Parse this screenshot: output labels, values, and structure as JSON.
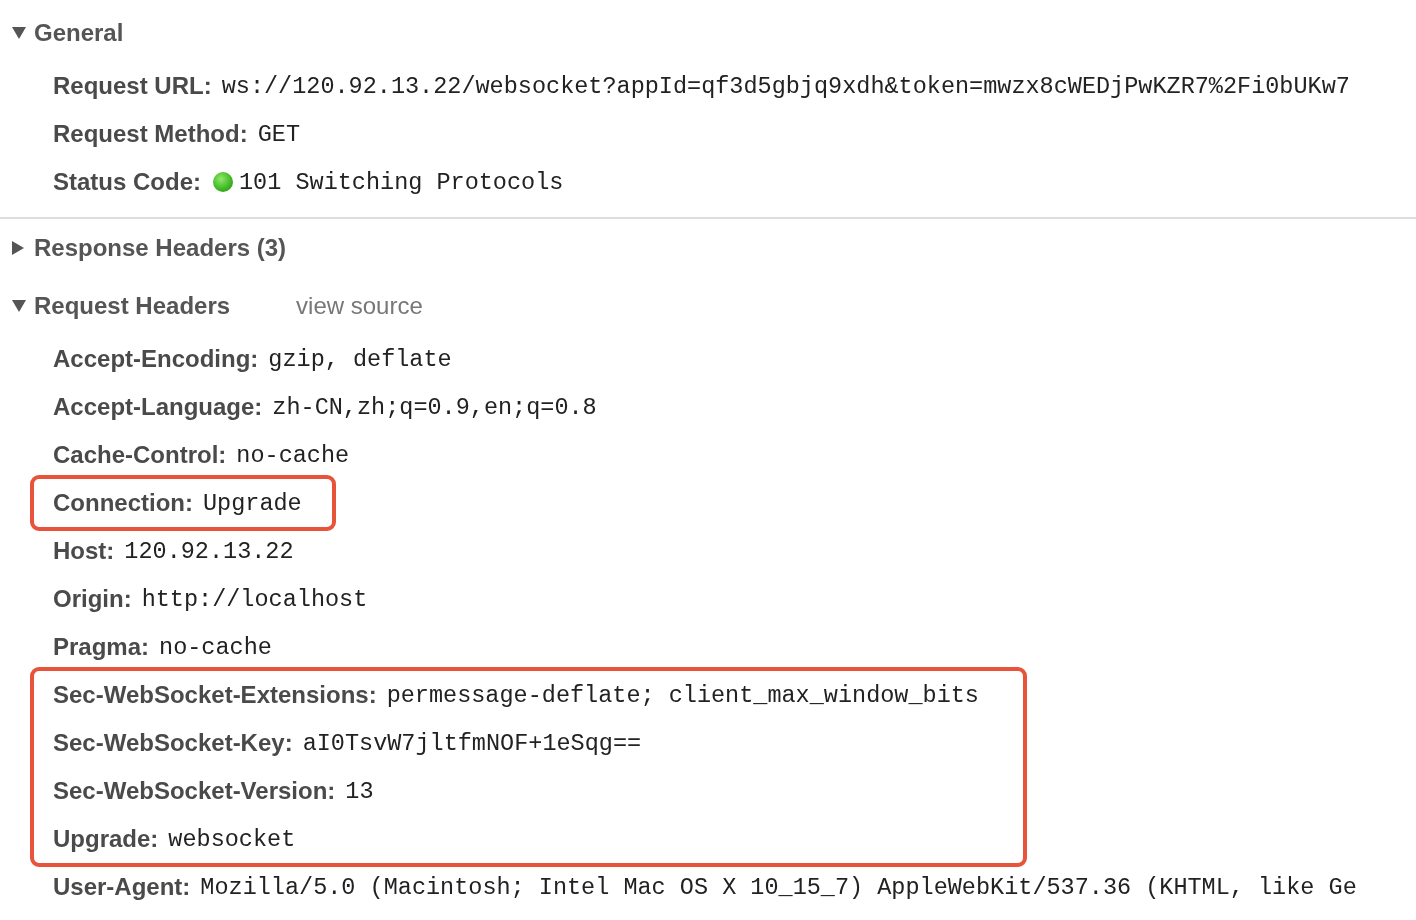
{
  "sections": [
    {
      "title": "General",
      "expanded": true,
      "rows": [
        {
          "label": "Request URL:",
          "value": "ws://120.92.13.22/websocket?appId=qf3d5gbjq9xdh&token=mwzx8cWEDjPwKZR7%2Fi0bUKw7"
        },
        {
          "label": "Request Method:",
          "value": "GET"
        },
        {
          "label": "Status Code:",
          "value": "101 Switching Protocols",
          "ok": true
        }
      ]
    },
    {
      "title": "Response Headers (3)",
      "expanded": false
    },
    {
      "title": "Request Headers",
      "expanded": true,
      "link": "view source",
      "groups": [
        {
          "highlighted": false,
          "rows": [
            {
              "label": "Accept-Encoding:",
              "value": "gzip, deflate"
            },
            {
              "label": "Accept-Language:",
              "value": "zh-CN,zh;q=0.9,en;q=0.8"
            },
            {
              "label": "Cache-Control:",
              "value": "no-cache"
            }
          ]
        },
        {
          "highlighted": true,
          "rows": [
            {
              "label": "Connection:",
              "value": "Upgrade"
            }
          ]
        },
        {
          "highlighted": false,
          "rows": [
            {
              "label": "Host:",
              "value": "120.92.13.22"
            },
            {
              "label": "Origin:",
              "value": "http://localhost"
            },
            {
              "label": "Pragma:",
              "value": "no-cache"
            }
          ]
        },
        {
          "highlighted": true,
          "rows": [
            {
              "label": "Sec-WebSocket-Extensions:",
              "value": "permessage-deflate; client_max_window_bits"
            },
            {
              "label": "Sec-WebSocket-Key:",
              "value": "aI0TsvW7jltfmNOF+1eSqg=="
            },
            {
              "label": "Sec-WebSocket-Version:",
              "value": "13"
            },
            {
              "label": "Upgrade:",
              "value": "websocket"
            }
          ]
        },
        {
          "highlighted": false,
          "rows": [
            {
              "label": "User-Agent:",
              "value": "Mozilla/5.0 (Macintosh; Intel Mac OS X 10_15_7) AppleWebKit/537.36 (KHTML, like Ge"
            }
          ]
        }
      ]
    }
  ]
}
